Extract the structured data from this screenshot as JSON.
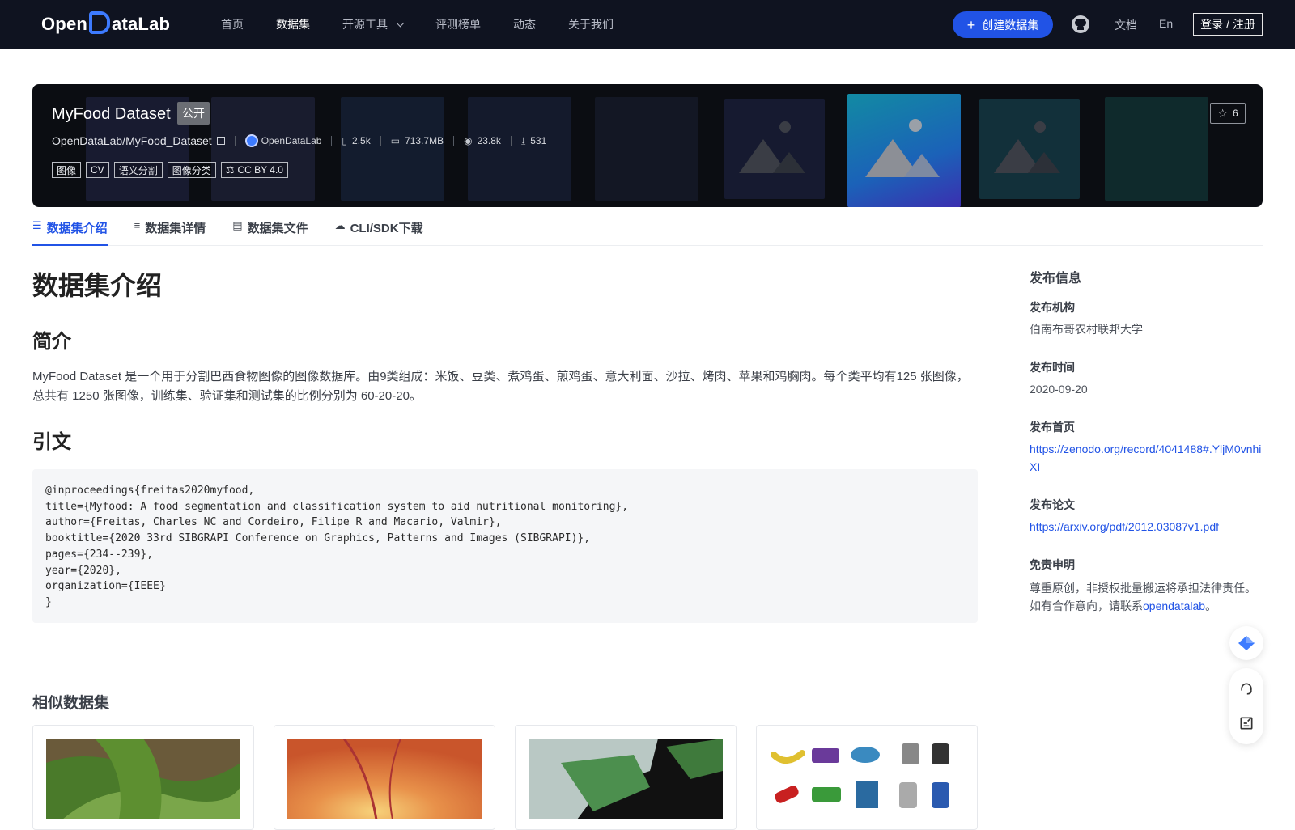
{
  "nav": {
    "logo": "OpenDataLab",
    "links": [
      "首页",
      "数据集",
      "开源工具",
      "评测榜单",
      "动态",
      "关于我们"
    ],
    "create_label": "创建数据集",
    "docs_label": "文档",
    "lang_label": "En",
    "login_label": "登录 / 注册"
  },
  "banner": {
    "title": "MyFood Dataset",
    "visibility": "公开",
    "path": "OpenDataLab/MyFood_Dataset",
    "org": "OpenDataLab",
    "files": "2.5k",
    "size": "713.7MB",
    "views": "23.8k",
    "downloads": "531",
    "tags": [
      "图像",
      "CV",
      "语义分割",
      "图像分类"
    ],
    "license": "CC BY 4.0",
    "stars": "6"
  },
  "tabs": [
    "数据集介绍",
    "数据集详情",
    "数据集文件",
    "CLI/SDK下载"
  ],
  "main": {
    "heading": "数据集介绍",
    "intro_heading": "简介",
    "intro_text": "MyFood Dataset 是一个用于分割巴西食物图像的图像数据库。由9类组成：米饭、豆类、煮鸡蛋、煎鸡蛋、意大利面、沙拉、烤肉、苹果和鸡胸肉。每个类平均有125 张图像，总共有 1250 张图像，训练集、验证集和测试集的比例分别为 60-20-20。",
    "cite_heading": "引文",
    "citation": [
      "@inproceedings{freitas2020myfood,",
      "title={Myfood: A food segmentation and classification system to aid nutritional monitoring},",
      "author={Freitas, Charles NC and Cordeiro, Filipe R and Macario, Valmir},",
      "booktitle={2020 33rd SIBGRAPI Conference on Graphics, Patterns and Images (SIBGRAPI)},",
      "pages={234--239},",
      "year={2020},",
      "organization={IEEE}",
      "}"
    ],
    "similar_heading": "相似数据集"
  },
  "sidebar": {
    "title": "发布信息",
    "org_label": "发布机构",
    "org_value": "伯南布哥农村联邦大学",
    "date_label": "发布时间",
    "date_value": "2020-09-20",
    "home_label": "发布首页",
    "home_url": "https://zenodo.org/record/4041488#.YljM0vnhiXI",
    "paper_label": "发布论文",
    "paper_url": "https://arxiv.org/pdf/2012.03087v1.pdf",
    "disclaimer_label": "免责申明",
    "disclaimer_text": "尊重原创，非授权批量搬运将承担法律责任。",
    "contact_prefix": "如有合作意向，请联系",
    "contact_link": "opendatalab",
    "contact_suffix": "。"
  },
  "colors": {
    "nav_bg": "#0f1320",
    "brand_blue": "#2153e6",
    "banner_bg": "#0b0d12"
  }
}
